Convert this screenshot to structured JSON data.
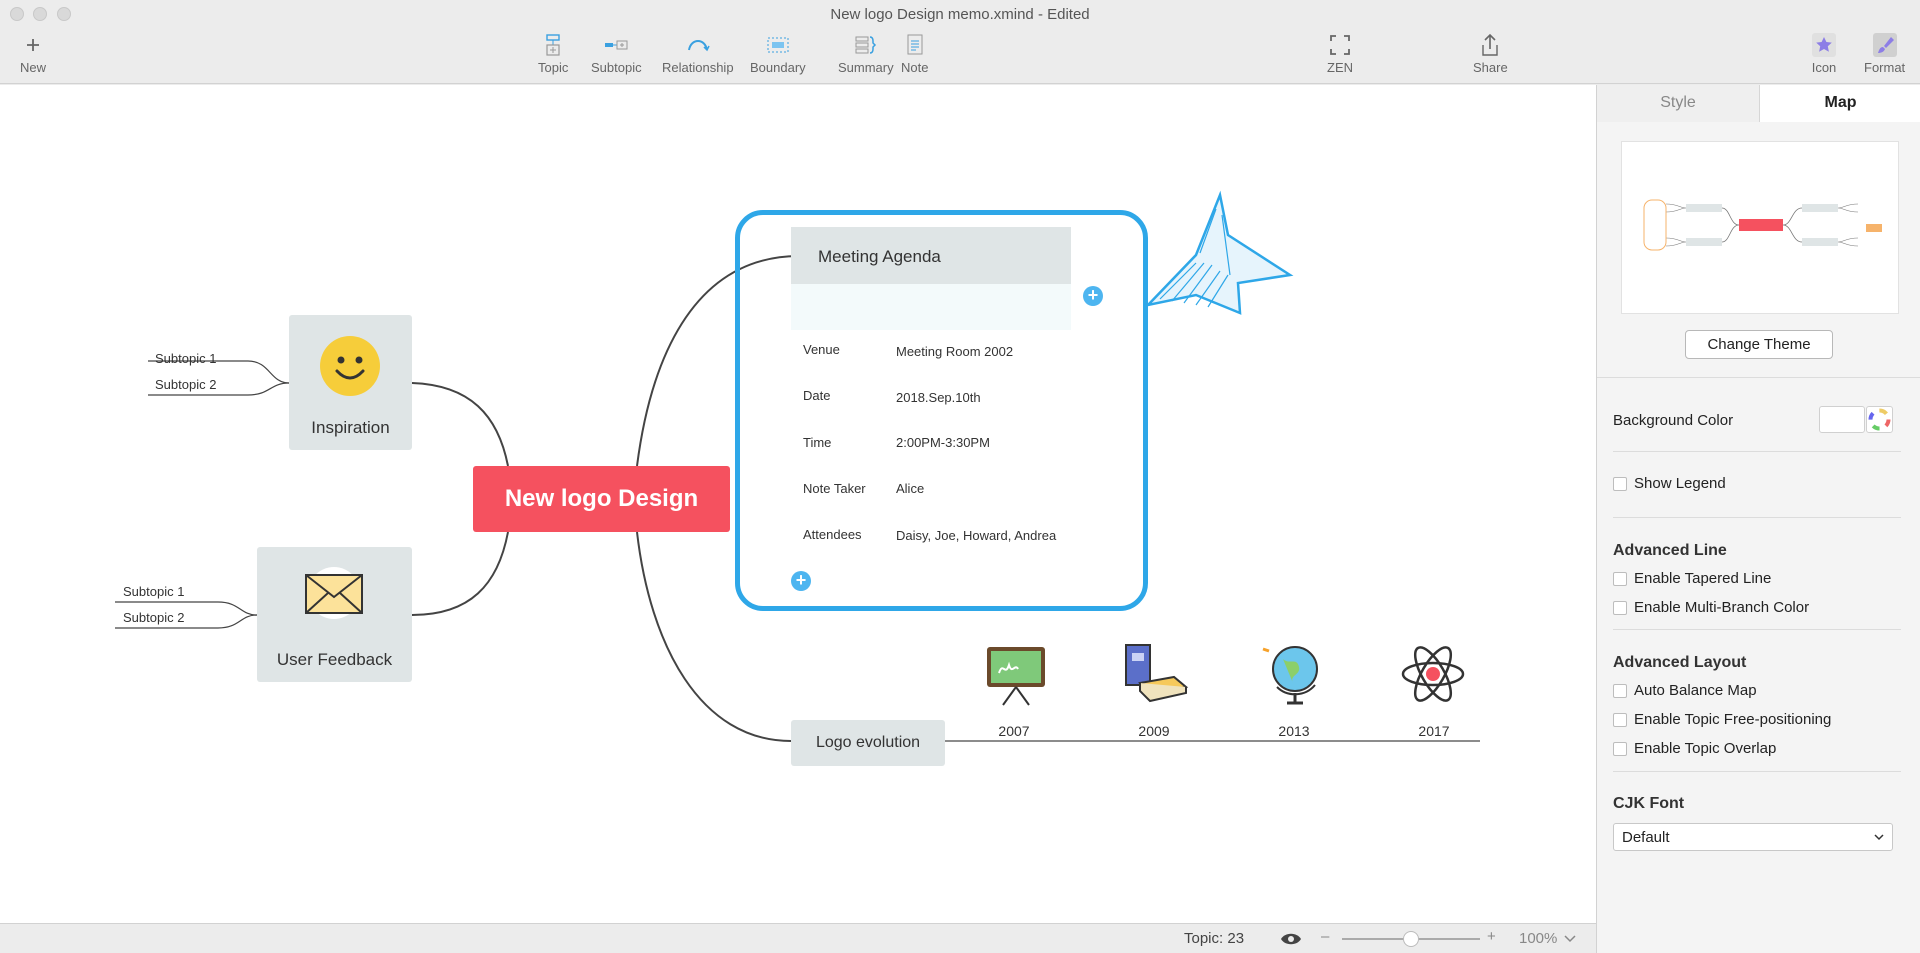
{
  "window": {
    "title": "New logo Design memo.xmind - Edited"
  },
  "toolbar": {
    "new": "New",
    "topic": "Topic",
    "subtopic": "Subtopic",
    "relationship": "Relationship",
    "boundary": "Boundary",
    "summary": "Summary",
    "note": "Note",
    "zen": "ZEN",
    "share": "Share",
    "icon": "Icon",
    "format": "Format"
  },
  "map": {
    "central": "New logo Design",
    "inspiration": {
      "label": "Inspiration",
      "subtopics": [
        "Subtopic 1",
        "Subtopic 2"
      ]
    },
    "feedback": {
      "label": "User Feedback",
      "subtopics": [
        "Subtopic 1",
        "Subtopic 2"
      ]
    },
    "agenda": {
      "title": "Meeting Agenda",
      "rows": [
        {
          "key": "Venue",
          "value": "Meeting Room 2002"
        },
        {
          "key": "Date",
          "value": "2018.Sep.10th"
        },
        {
          "key": "Time",
          "value": "2:00PM-3:30PM"
        },
        {
          "key": "Note Taker",
          "value": "Alice"
        },
        {
          "key": "Attendees",
          "value": "Daisy, Joe, Howard, Andrea"
        }
      ]
    },
    "evolution": {
      "label": "Logo evolution",
      "years": [
        "2007",
        "2009",
        "2013",
        "2017"
      ]
    }
  },
  "status": {
    "topic_count": "Topic: 23",
    "zoom": "100%"
  },
  "panel": {
    "tabs": [
      "Style",
      "Map"
    ],
    "active_tab": "Map",
    "change_theme": "Change Theme",
    "background_color": "Background Color",
    "show_legend": "Show Legend",
    "advanced_line": {
      "title": "Advanced Line",
      "options": [
        "Enable Tapered Line",
        "Enable Multi-Branch Color"
      ]
    },
    "advanced_layout": {
      "title": "Advanced Layout",
      "options": [
        "Auto Balance Map",
        "Enable Topic Free-positioning",
        "Enable Topic Overlap"
      ]
    },
    "cjk_font": {
      "title": "CJK Font",
      "value": "Default"
    }
  },
  "colors": {
    "central": "#f5515f",
    "accent": "#2ea7e8",
    "card": "#dfe5e6"
  }
}
